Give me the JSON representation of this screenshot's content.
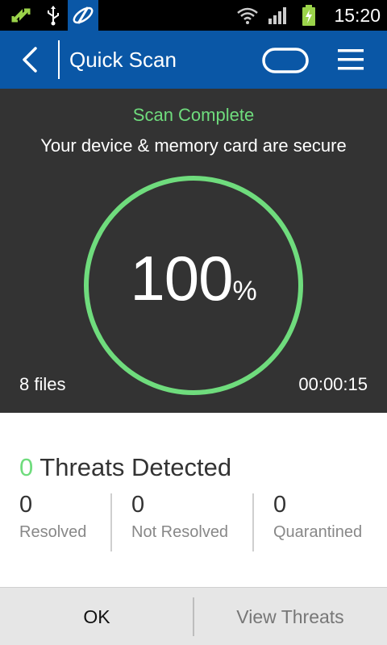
{
  "status_bar": {
    "time": "15:20",
    "icons": [
      "transfer-arrows-icon",
      "usb-icon",
      "app-shield-icon",
      "wifi-icon",
      "signal-bars-icon",
      "battery-charging-icon"
    ]
  },
  "header": {
    "title": "Quick Scan",
    "back_icon": "back-chevron-icon",
    "action_icon": "pill-icon",
    "menu_icon": "menu-icon",
    "background_color": "#0a57a6"
  },
  "scan": {
    "status": "Scan Complete",
    "subtitle": "Your device & memory card are secure",
    "percent_value": "100",
    "percent_sign": "%",
    "progress_fraction": 1.0,
    "files": "8 files",
    "elapsed": "00:00:15",
    "accent_color": "#6fdc7d"
  },
  "results": {
    "threats_count": "0",
    "threats_label": " Threats Detected",
    "stats": [
      {
        "value": "0",
        "label": "Resolved"
      },
      {
        "value": "0",
        "label": "Not Resolved"
      },
      {
        "value": "0",
        "label": "Quarantined"
      }
    ]
  },
  "footer": {
    "ok_label": "OK",
    "view_threats_label": "View Threats"
  }
}
